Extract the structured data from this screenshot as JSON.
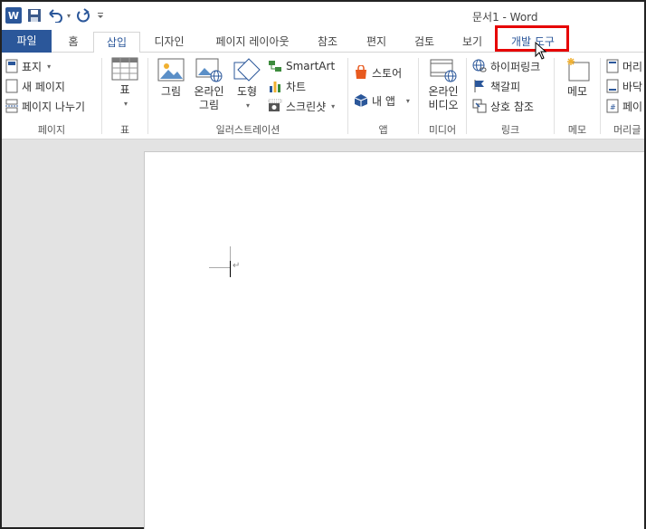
{
  "window": {
    "title": "문서1 - Word"
  },
  "tabs": {
    "file": "파일",
    "home": "홈",
    "insert": "삽입",
    "design": "디자인",
    "layout": "페이지 레이아웃",
    "references": "참조",
    "mailings": "편지",
    "review": "검토",
    "view": "보기",
    "developer": "개발 도구"
  },
  "ribbon": {
    "pages": {
      "label": "페이지",
      "cover": "표지",
      "blank": "새 페이지",
      "break": "페이지 나누기"
    },
    "tables": {
      "label": "표",
      "table": "표"
    },
    "illustrations": {
      "label": "일러스트레이션",
      "picture": "그림",
      "online_picture_1": "온라인",
      "online_picture_2": "그림",
      "shapes": "도형",
      "smartart": "SmartArt",
      "chart": "차트",
      "screenshot": "스크린샷"
    },
    "apps": {
      "label": "앱",
      "store": "스토어",
      "my_apps": "내 앱"
    },
    "media": {
      "label": "미디어",
      "online_video_1": "온라인",
      "online_video_2": "비디오"
    },
    "links": {
      "label": "링크",
      "hyperlink": "하이퍼링크",
      "bookmark": "책갈피",
      "cross_ref": "상호 참조"
    },
    "comments": {
      "label": "메모",
      "comment": "메모"
    },
    "header_footer": {
      "label": "머리글",
      "header": "머리",
      "footer": "바닥",
      "page_number": "페이"
    }
  },
  "document": {
    "paragraph_mark": "↵"
  },
  "colors": {
    "accent": "#2b579a",
    "highlight": "#e60000"
  }
}
